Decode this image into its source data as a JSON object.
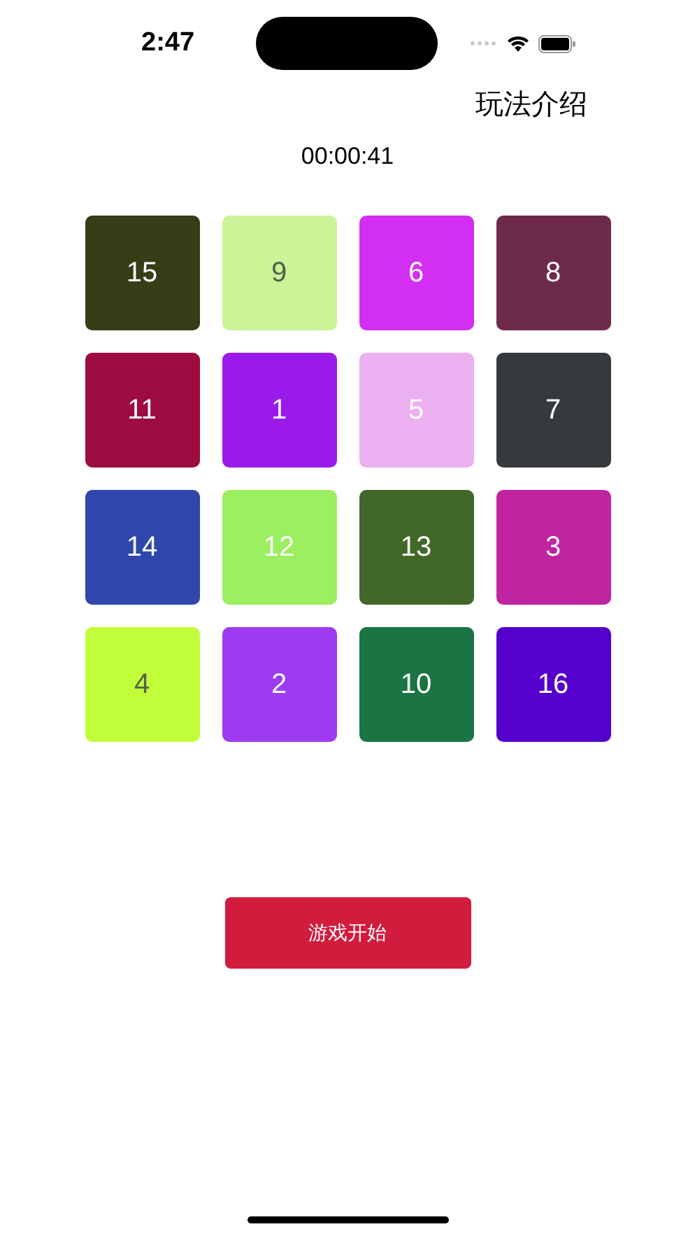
{
  "status_bar": {
    "time": "2:47"
  },
  "nav": {
    "title": "玩法介绍"
  },
  "timer": "00:00:41",
  "tiles": [
    {
      "label": "15",
      "color": "#383c17"
    },
    {
      "label": "9",
      "color": "#caf497"
    },
    {
      "label": "6",
      "color": "#d22ff2"
    },
    {
      "label": "8",
      "color": "#6e2a4a"
    },
    {
      "label": "11",
      "color": "#9d0c40"
    },
    {
      "label": "1",
      "color": "#9a1be9"
    },
    {
      "label": "5",
      "color": "#ebb0f0"
    },
    {
      "label": "7",
      "color": "#363a3e"
    },
    {
      "label": "14",
      "color": "#2f47ad"
    },
    {
      "label": "12",
      "color": "#9cef5f"
    },
    {
      "label": "13",
      "color": "#416828"
    },
    {
      "label": "3",
      "color": "#c024a0"
    },
    {
      "label": "4",
      "color": "#c2fd3a"
    },
    {
      "label": "2",
      "color": "#9d3af2"
    },
    {
      "label": "10",
      "color": "#1b7443"
    },
    {
      "label": "16",
      "color": "#5500cc"
    }
  ],
  "start_button": "游戏开始"
}
